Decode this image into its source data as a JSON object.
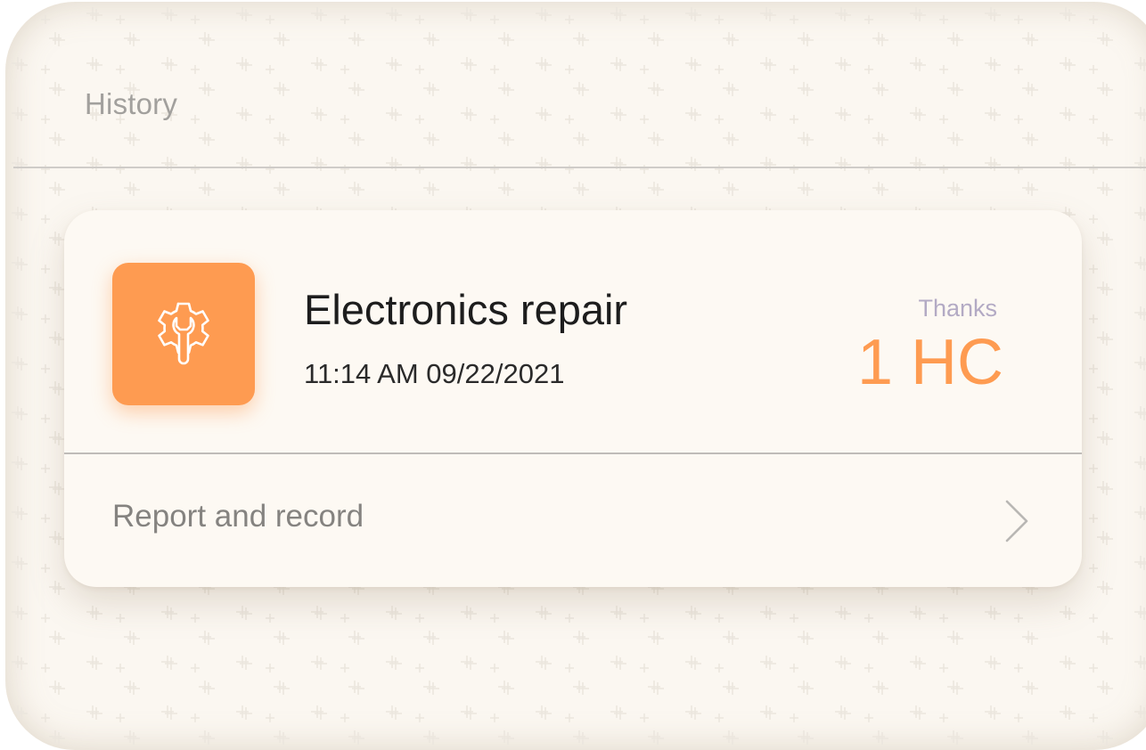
{
  "header": {
    "title": "History"
  },
  "record": {
    "service_name": "Electronics repair",
    "timestamp": "11:14 AM 09/22/2021",
    "reward_label": "Thanks",
    "reward_amount": "1 HC",
    "icon": "gear-wrench-icon"
  },
  "actions": {
    "report_label": "Report and record",
    "report_icon": "chevron-right-icon"
  },
  "colors": {
    "accent": "#fe9b51",
    "background": "#fbf7f1",
    "card": "#fdf9f3",
    "muted_text": "#a2a09d",
    "thanks_text": "#b3aac4"
  }
}
